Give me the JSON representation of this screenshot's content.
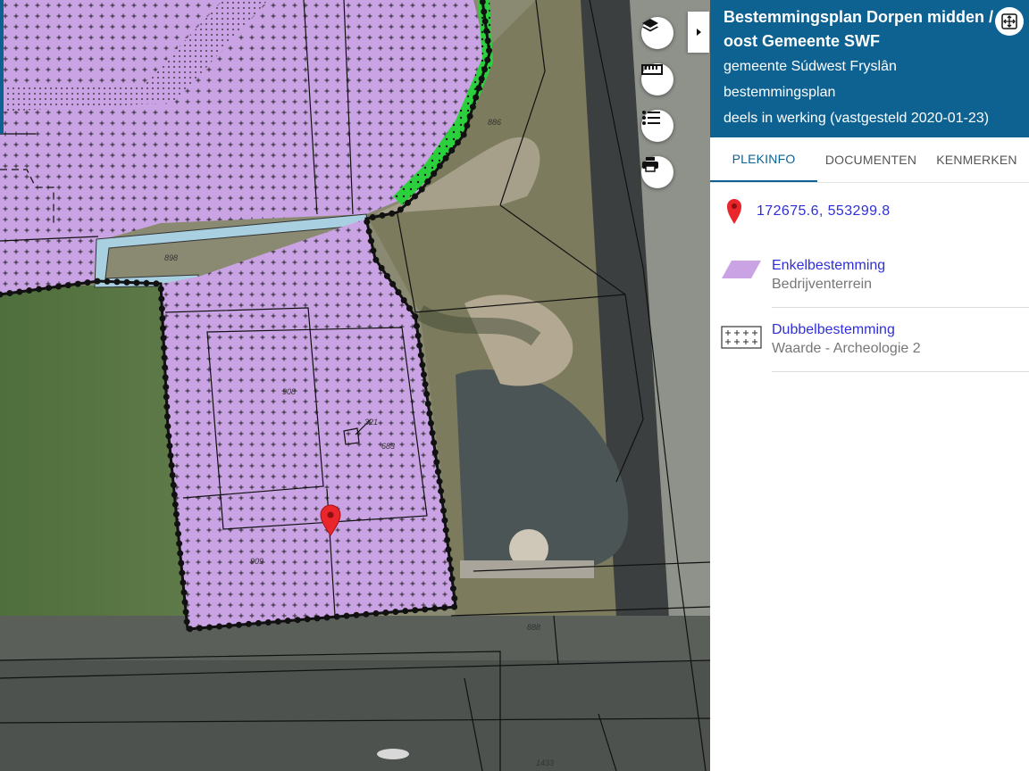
{
  "map": {
    "parcel_labels": [
      "886",
      "898",
      "908",
      "321",
      "683",
      "909",
      "888",
      "1433"
    ],
    "colors": {
      "enkelbestemming_fill": "#c9a3e3",
      "groen_fill": "#2bd13c",
      "water_fill": "#a9d0e0",
      "marker": "#e8262b"
    },
    "controls": [
      "layers-icon",
      "ruler-icon",
      "legend-list-icon",
      "print-icon",
      "caret-right-icon"
    ]
  },
  "panel": {
    "plan_title": "Bestemmingsplan Dorpen midden / oost Gemeente SWF",
    "municipality": "gemeente Súdwest Fryslân",
    "plan_type": "bestemmingsplan",
    "status": "deels in werking (vastgesteld 2020-01-23)",
    "tabs": [
      "PLEKINFO",
      "DOCUMENTEN",
      "KENMERKEN"
    ],
    "coordinates": "172675.6, 553299.8",
    "destinations": [
      {
        "title": "Enkelbestemming",
        "subtitle": "Bedrijventerrein",
        "symbol": "purple-parallelogram"
      },
      {
        "title": "Dubbelbestemming",
        "subtitle": "Waarde - Archeologie 2",
        "symbol": "plus-pattern"
      }
    ],
    "header_color": "#0e6292",
    "link_color": "#2f2fd8"
  }
}
